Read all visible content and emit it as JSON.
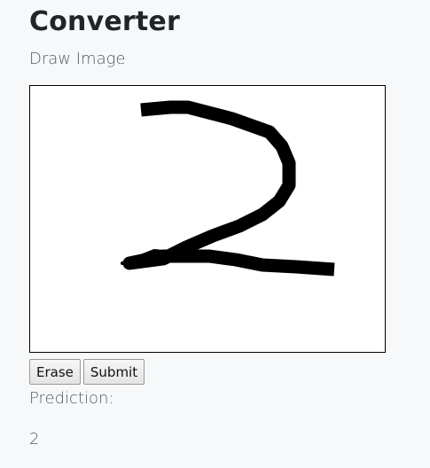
{
  "header": {
    "title": "Converter",
    "subtitle": "Draw Image"
  },
  "canvas": {
    "stroke_color": "#000000",
    "background_color": "#ffffff"
  },
  "buttons": {
    "erase_label": "Erase",
    "submit_label": "Submit"
  },
  "prediction": {
    "label": "Prediction:",
    "value": "2"
  }
}
